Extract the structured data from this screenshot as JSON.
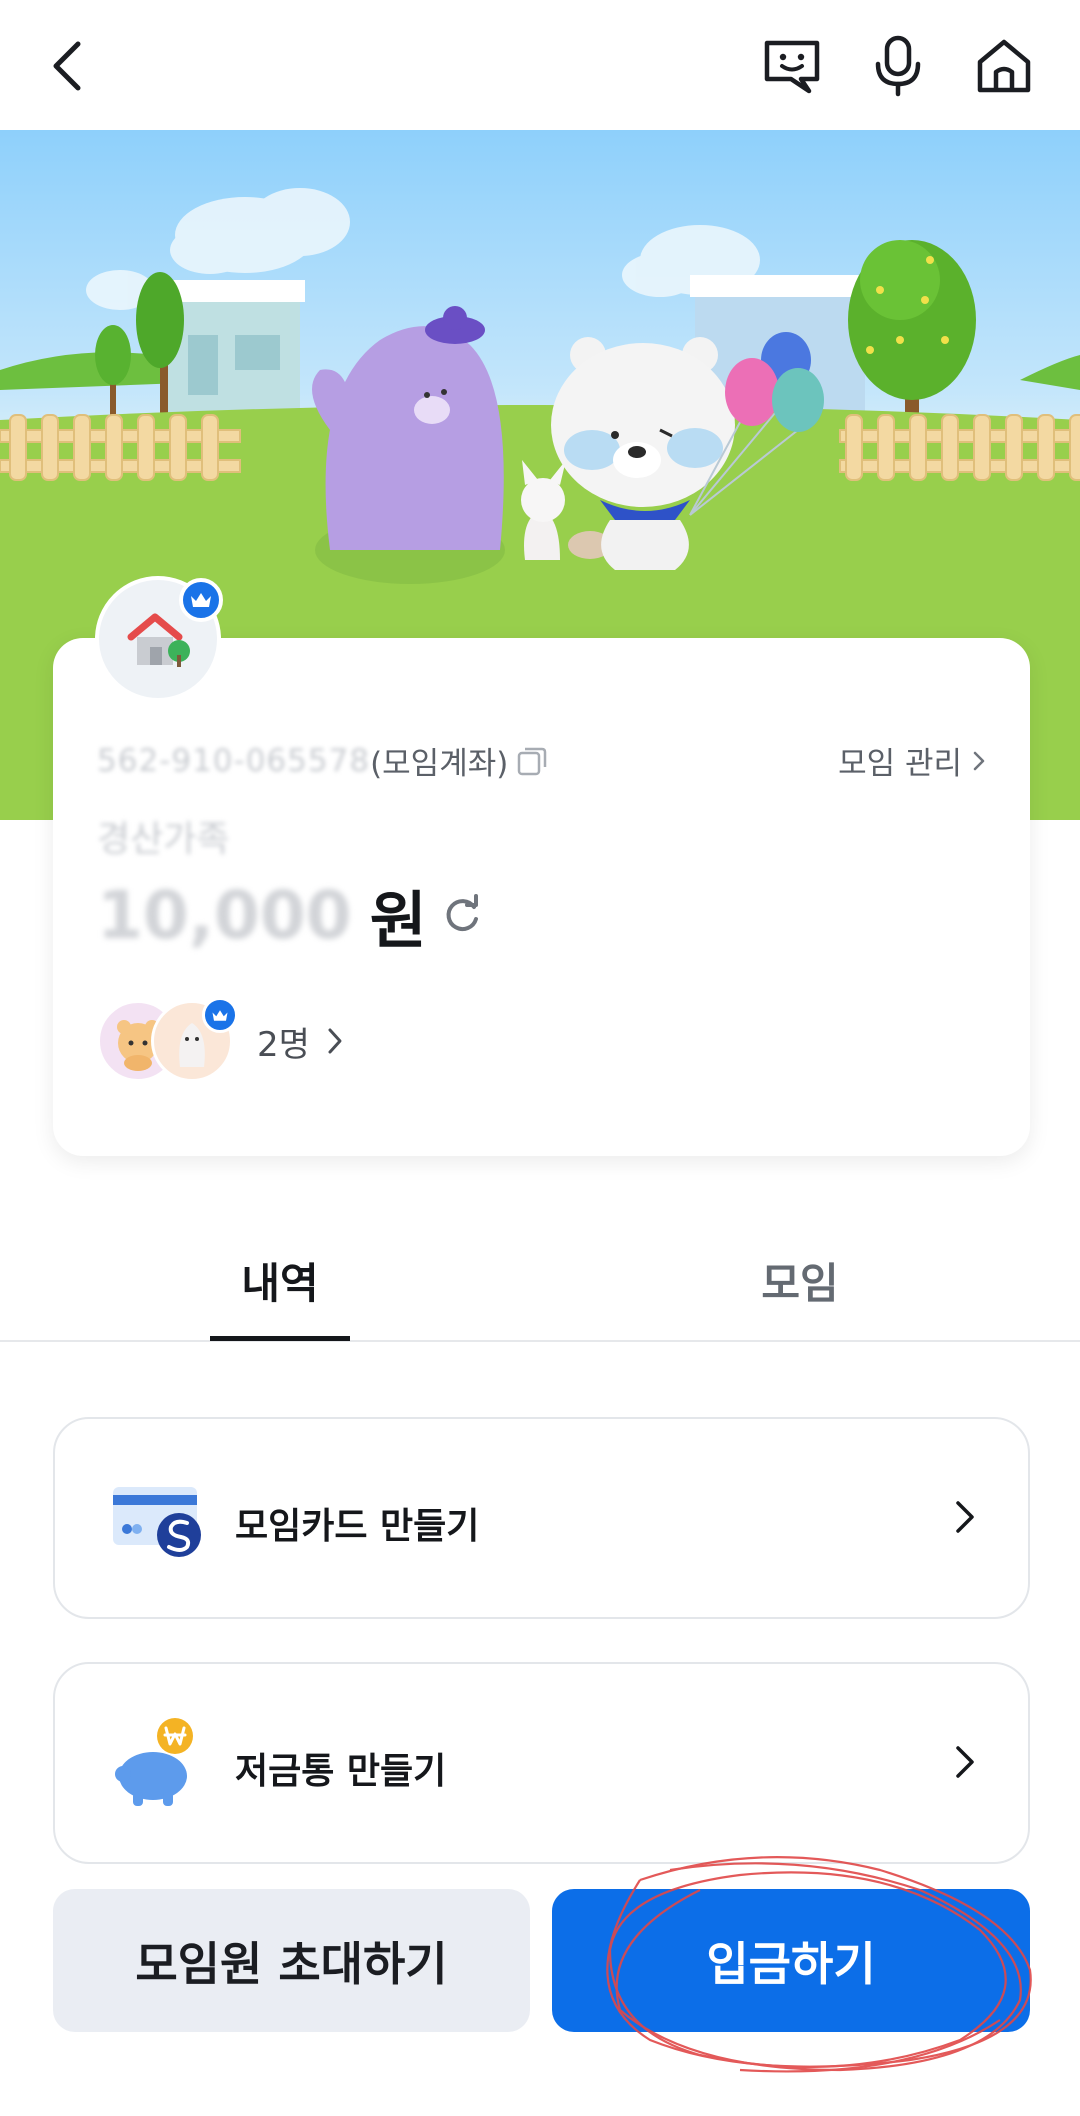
{
  "topbar": {
    "back_icon": "chevron-left-icon",
    "actions": [
      "chat-bubble-icon",
      "microphone-icon",
      "home-icon"
    ]
  },
  "card": {
    "account_number": "562-910-065578",
    "account_type": "(모임계좌)",
    "manage_label": "모임 관리",
    "account_name": "경산가족",
    "balance_amount": "10,000",
    "currency_unit": "원",
    "member_count": "2명"
  },
  "tabs": [
    {
      "label": "내역",
      "active": true
    },
    {
      "label": "모임",
      "active": false
    }
  ],
  "list": [
    {
      "label": "모임카드 만들기",
      "icon": "card-icon"
    },
    {
      "label": "저금통 만들기",
      "icon": "piggy-bank-icon"
    }
  ],
  "buttons": {
    "invite_label": "모임원 초대하기",
    "deposit_label": "입금하기"
  },
  "colors": {
    "primary": "#0c6ee8",
    "secondary_button": "#eaedf3",
    "badge": "#1a73e8"
  }
}
